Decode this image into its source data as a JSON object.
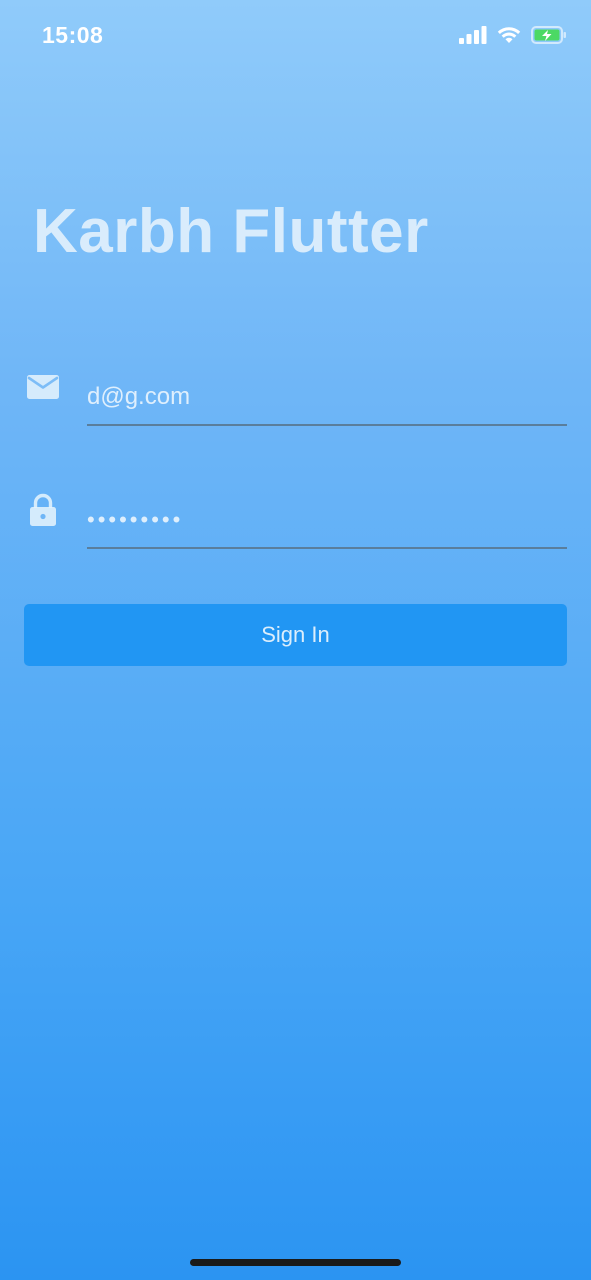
{
  "status_bar": {
    "time": "15:08",
    "icons": [
      "signal-icon",
      "wifi-icon",
      "battery-charging-icon"
    ],
    "battery_color": "#4cd964"
  },
  "app": {
    "title": "Karbh Flutter"
  },
  "form": {
    "email": {
      "icon": "mail-icon",
      "value": "d@g.com"
    },
    "password": {
      "icon": "lock-icon",
      "value": "•••••••••"
    },
    "submit_label": "Sign In"
  },
  "colors": {
    "button": "#2196f3",
    "underline": "#5a7e9c"
  }
}
